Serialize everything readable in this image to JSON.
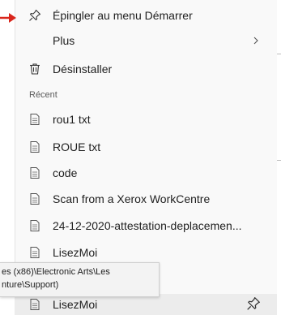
{
  "menu": {
    "pin_start": "Épingler au menu Démarrer",
    "more": "Plus",
    "uninstall": "Désinstaller",
    "recent_header": "Récent",
    "recent_items": [
      "rou1 txt",
      "ROUE  txt",
      "code",
      "Scan from a Xerox WorkCentre",
      "24-12-2020-attestation-deplacemen...",
      "LisezMoi",
      "LisezMoi"
    ]
  },
  "tooltip": {
    "line1": "es (x86)\\Electronic Arts\\Les",
    "line2": "nture\\Support)"
  },
  "colors": {
    "accent_arrow": "#d9261c",
    "menu_bg": "#f9f9f9",
    "text": "#1f1f1f"
  },
  "icons": {
    "pin": "pin-icon",
    "chevron": "chevron-right-icon",
    "trash": "trash-icon",
    "document": "document-icon"
  }
}
